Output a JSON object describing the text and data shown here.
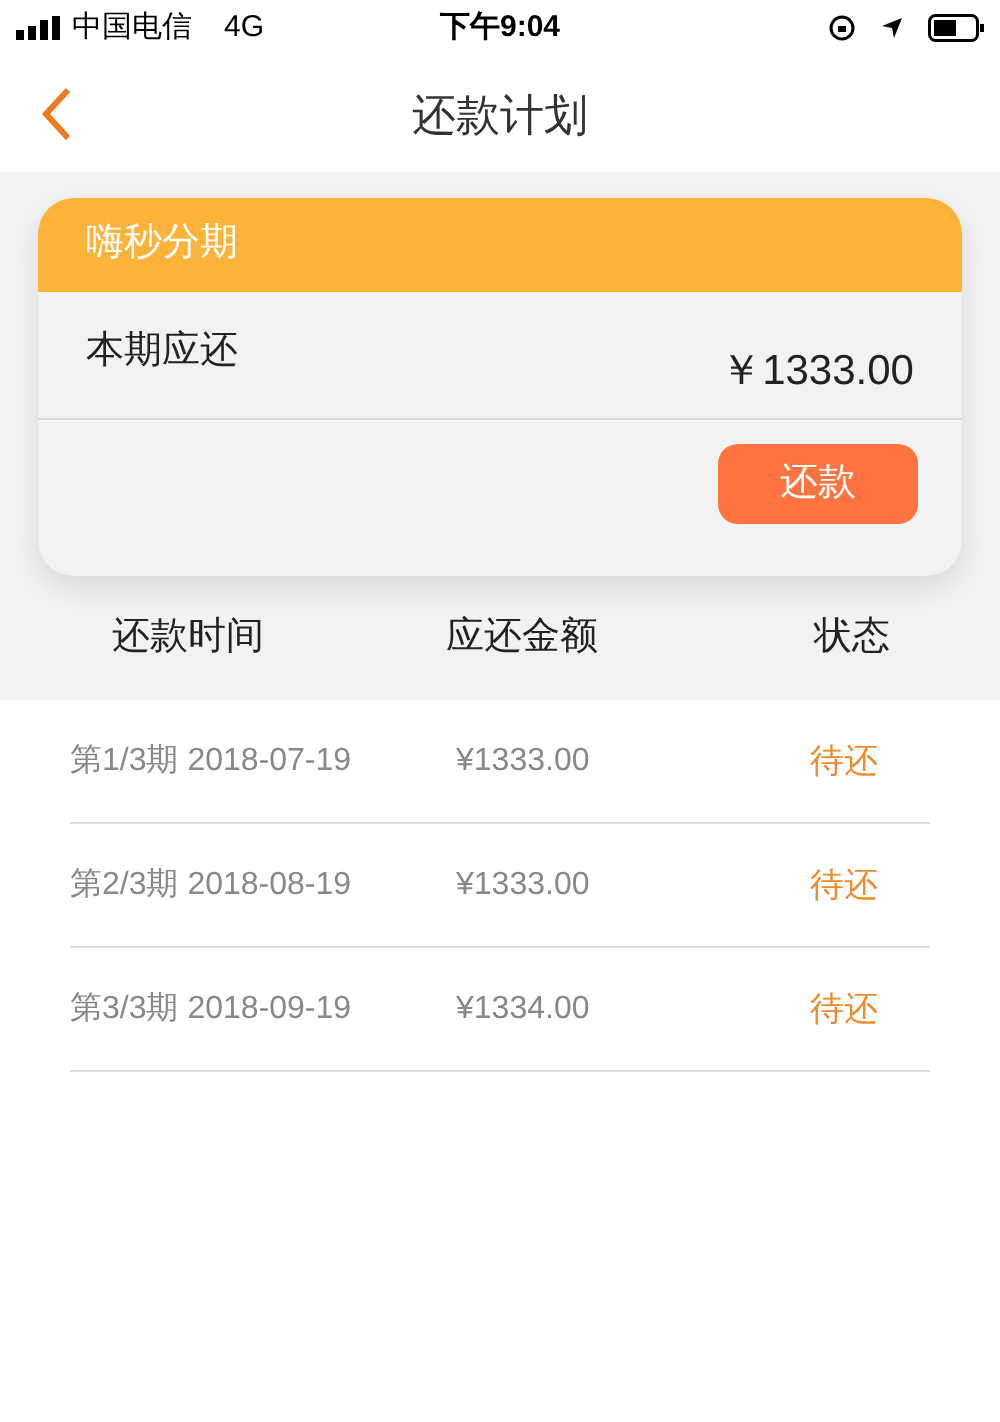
{
  "status_bar": {
    "carrier": "中国电信",
    "network": "4G",
    "time": "下午9:04"
  },
  "nav": {
    "title": "还款计划"
  },
  "card": {
    "header": "嗨秒分期",
    "label": "本期应还",
    "amount": "￥1333.00",
    "button": "还款"
  },
  "table": {
    "columns": [
      "还款时间",
      "应还金额",
      "状态"
    ],
    "rows": [
      {
        "period": "第1/3期 2018-07-19",
        "amount": "¥1333.00",
        "status": "待还"
      },
      {
        "period": "第2/3期 2018-08-19",
        "amount": "¥1333.00",
        "status": "待还"
      },
      {
        "period": "第3/3期 2018-09-19",
        "amount": "¥1334.00",
        "status": "待还"
      }
    ]
  }
}
